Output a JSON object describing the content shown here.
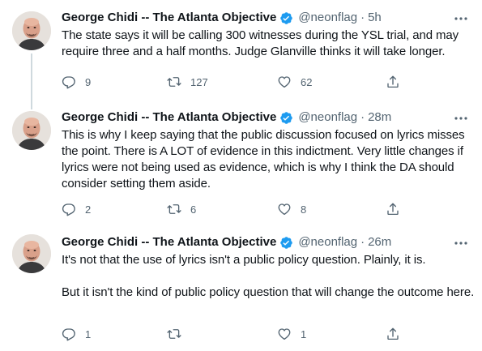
{
  "tweets": [
    {
      "author": {
        "name": "George Chidi -- The Atlanta Objective",
        "handle": "@neonflag",
        "separator": "·",
        "time": "5h"
      },
      "text": "The state says it will be calling 300 witnesses during the YSL trial, and may require three and a half months. Judge Glanville thinks it will take longer.",
      "actions": {
        "reply_count": "9",
        "retweet_count": "127",
        "like_count": "62"
      }
    },
    {
      "author": {
        "name": "George Chidi -- The Atlanta Objective",
        "handle": "@neonflag",
        "separator": "·",
        "time": "28m"
      },
      "text": "This is why I keep saying that the public discussion focused on lyrics misses the point. There is A LOT of evidence in this indictment. Very little changes if lyrics were not being used as evidence, which is why I think the DA should consider setting them aside.",
      "actions": {
        "reply_count": "2",
        "retweet_count": "6",
        "like_count": "8"
      }
    },
    {
      "author": {
        "name": "George Chidi -- The Atlanta Objective",
        "handle": "@neonflag",
        "separator": "·",
        "time": "26m"
      },
      "text": "It's not that the use of lyrics isn't a public policy question. Plainly, it is.\n\nBut it isn't the kind of public policy question that will change the outcome here.",
      "actions": {
        "reply_count": "1",
        "retweet_count": "",
        "like_count": "1"
      }
    }
  ],
  "colors": {
    "text": "#0f1419",
    "secondary": "#536471",
    "verified": "#1d9bf0",
    "thread_line": "#cfd9de"
  },
  "icons": [
    "verified-badge-icon",
    "more-icon",
    "reply-icon",
    "retweet-icon",
    "like-icon",
    "share-icon"
  ]
}
